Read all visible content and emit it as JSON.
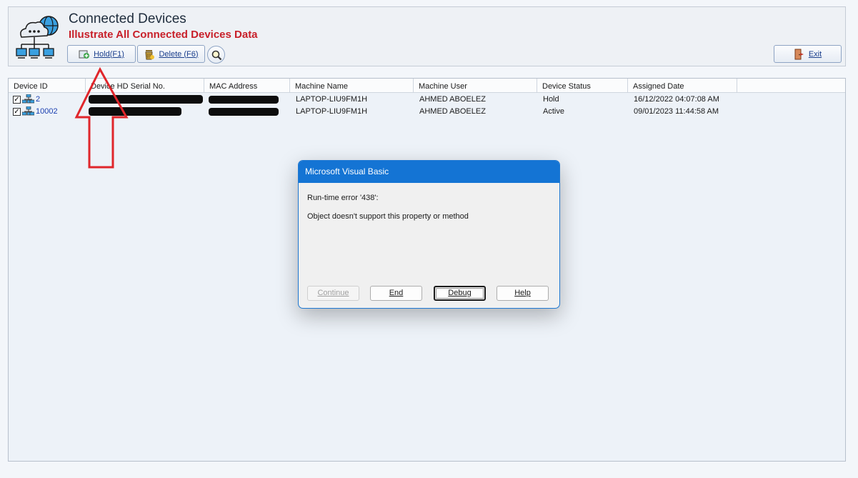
{
  "header": {
    "title": "Connected Devices",
    "subtitle": "Illustrate All Connected Devices Data",
    "hold_label": "Hold(F1)",
    "delete_label": "Delete (F6)",
    "exit_label": "Exit",
    "search_icon": "magnifier-icon",
    "logo_icon": "cloud-network-icon"
  },
  "grid": {
    "columns": [
      "Device ID",
      "Device HD Serial No.",
      "MAC Address",
      "Machine Name",
      "Machine User",
      "Device Status",
      "Assigned Date"
    ],
    "rows": [
      {
        "checked": true,
        "device_id": "2",
        "machine_name": "LAPTOP-LIU9FM1H",
        "machine_user": "AHMED ABOELEZ",
        "status": "Hold",
        "assigned_date": "16/12/2022 04:07:08 AM"
      },
      {
        "checked": true,
        "device_id": "10002",
        "machine_name": "LAPTOP-LIU9FM1H",
        "machine_user": "AHMED ABOELEZ",
        "status": "Active",
        "assigned_date": "09/01/2023 11:44:58 AM"
      }
    ]
  },
  "dialog": {
    "title": "Microsoft Visual Basic",
    "line1": "Run-time error '438':",
    "line2": "Object doesn't support this property or method",
    "buttons": {
      "continue": "Continue",
      "end": "End",
      "debug": "Debug",
      "help": "Help"
    }
  },
  "colors": {
    "subtitle": "#c8202a",
    "dialog_title_bar": "#1474d4",
    "annotation_arrow": "#e0262b",
    "redaction": "#0d0d0d"
  }
}
